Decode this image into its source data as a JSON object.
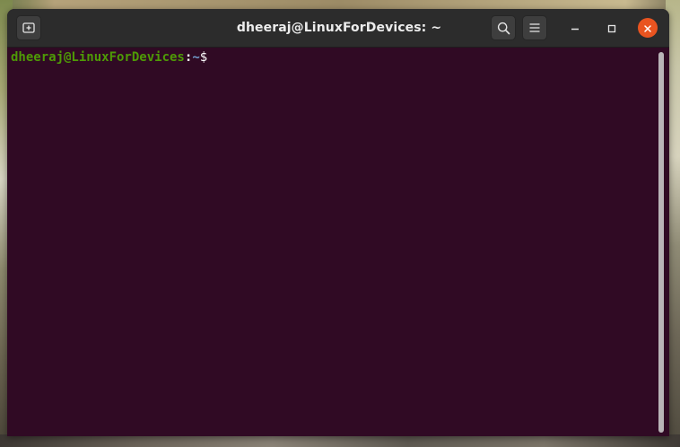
{
  "window": {
    "title": "dheeraj@LinuxForDevices: ~"
  },
  "titlebar": {
    "new_tab_icon": "new-tab-icon",
    "search_icon": "search-icon",
    "menu_icon": "hamburger-menu-icon",
    "minimize_icon": "minimize-icon",
    "maximize_icon": "maximize-icon",
    "close_icon": "close-icon"
  },
  "terminal": {
    "prompt_user_host": "dheeraj@LinuxForDevices",
    "prompt_colon": ":",
    "prompt_path": "~",
    "prompt_symbol": "$"
  },
  "colors": {
    "terminal_background": "#300a24",
    "titlebar_background": "#2c2c2c",
    "prompt_user": "#4e9a06",
    "prompt_path": "#729fcf",
    "close_button": "#e95420"
  }
}
